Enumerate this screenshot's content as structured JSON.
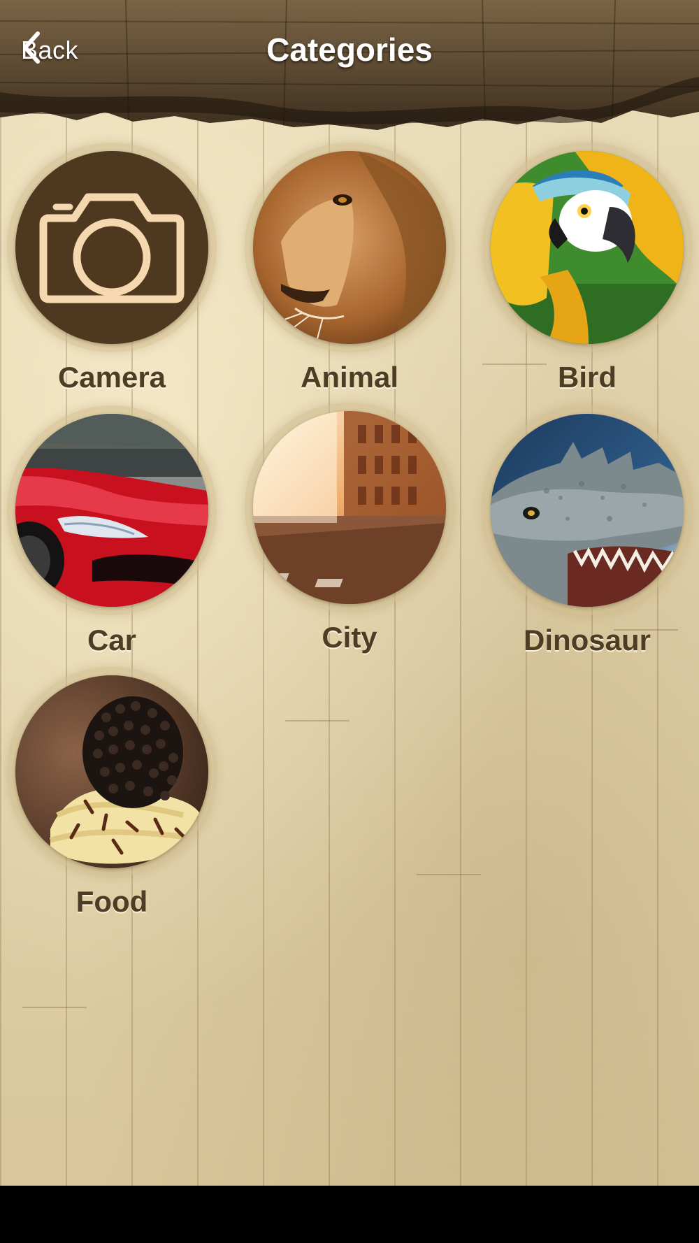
{
  "header": {
    "back_label": "Back",
    "title": "Categories"
  },
  "categories": [
    {
      "label": "Camera",
      "icon": "camera-icon"
    },
    {
      "label": "Animal",
      "icon": "lion-image"
    },
    {
      "label": "Bird",
      "icon": "parrot-image"
    },
    {
      "label": "Car",
      "icon": "car-image"
    },
    {
      "label": "City",
      "icon": "city-street-image"
    },
    {
      "label": "Dinosaur",
      "icon": "dinosaur-image"
    },
    {
      "label": "Food",
      "icon": "dessert-image"
    }
  ],
  "colors": {
    "header_wood": "#4a3a26",
    "label_text": "#4e3c24",
    "camera_bg": "#4e3820",
    "camera_icon": "#f6d8b0",
    "background": "#e5d7b3"
  }
}
